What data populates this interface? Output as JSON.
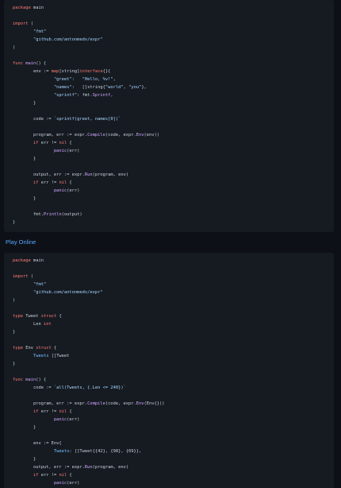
{
  "play_online": "Play Online",
  "colors": {
    "keyword": "#ff7b72",
    "string": "#a5d6ff",
    "function": "#d2a8ff",
    "type": "#79c0ff",
    "plain": "#c9d1d9",
    "link": "#58a6ff",
    "code_bg": "#161b22",
    "page_bg": "#0d1117"
  },
  "code_blocks": [
    {
      "lines": [
        {
          "row": 0,
          "tokens": [
            {
              "t": "package ",
              "c": "kw"
            },
            {
              "t": "main",
              "c": "pl"
            }
          ]
        },
        {
          "row": 2,
          "tokens": [
            {
              "t": "import ",
              "c": "kw"
            },
            {
              "t": "(",
              "c": "pl"
            }
          ]
        },
        {
          "row": 3,
          "tokens": [
            {
              "t": "        ",
              "c": "pl"
            },
            {
              "t": "\"fmt\"",
              "c": "str"
            }
          ]
        },
        {
          "row": 4,
          "tokens": [
            {
              "t": "        ",
              "c": "pl"
            },
            {
              "t": "\"github.com/antonmedv/expr\"",
              "c": "str"
            }
          ]
        },
        {
          "row": 5,
          "tokens": [
            {
              "t": ")",
              "c": "pl"
            }
          ]
        },
        {
          "row": 7,
          "tokens": [
            {
              "t": "func ",
              "c": "kw"
            },
            {
              "t": "main",
              "c": "fn"
            },
            {
              "t": "() {",
              "c": "pl"
            }
          ]
        },
        {
          "row": 8,
          "tokens": [
            {
              "t": "        env := ",
              "c": "pl"
            },
            {
              "t": "map",
              "c": "kw"
            },
            {
              "t": "[string]",
              "c": "pl"
            },
            {
              "t": "interface",
              "c": "kw"
            },
            {
              "t": "{}{",
              "c": "pl"
            }
          ]
        },
        {
          "row": 9,
          "tokens": [
            {
              "t": "                ",
              "c": "pl"
            },
            {
              "t": "\"greet\"",
              "c": "str"
            },
            {
              "t": ":   ",
              "c": "pl"
            },
            {
              "t": "\"Hello, %v!\"",
              "c": "str"
            },
            {
              "t": ",",
              "c": "pl"
            }
          ]
        },
        {
          "row": 10,
          "tokens": [
            {
              "t": "                ",
              "c": "pl"
            },
            {
              "t": "\"names\"",
              "c": "str"
            },
            {
              "t": ":   []string{",
              "c": "pl"
            },
            {
              "t": "\"world\"",
              "c": "str"
            },
            {
              "t": ", ",
              "c": "pl"
            },
            {
              "t": "\"you\"",
              "c": "str"
            },
            {
              "t": "},",
              "c": "pl"
            }
          ]
        },
        {
          "row": 11,
          "tokens": [
            {
              "t": "                ",
              "c": "pl"
            },
            {
              "t": "\"sprintf\"",
              "c": "str"
            },
            {
              "t": ": fmt.",
              "c": "pl"
            },
            {
              "t": "Sprintf",
              "c": "fn"
            },
            {
              "t": ",",
              "c": "pl"
            }
          ]
        },
        {
          "row": 12,
          "tokens": [
            {
              "t": "        }",
              "c": "pl"
            }
          ]
        },
        {
          "row": 14,
          "tokens": [
            {
              "t": "        code := ",
              "c": "pl"
            },
            {
              "t": "`sprintf(greet, names[0])`",
              "c": "str"
            }
          ]
        },
        {
          "row": 16,
          "tokens": [
            {
              "t": "        program, err := expr.",
              "c": "pl"
            },
            {
              "t": "Compile",
              "c": "fn"
            },
            {
              "t": "(code, expr.",
              "c": "pl"
            },
            {
              "t": "Env",
              "c": "fn"
            },
            {
              "t": "(env))",
              "c": "pl"
            }
          ]
        },
        {
          "row": 17,
          "tokens": [
            {
              "t": "        ",
              "c": "pl"
            },
            {
              "t": "if ",
              "c": "kw"
            },
            {
              "t": "err != ",
              "c": "pl"
            },
            {
              "t": "nil",
              "c": "kw"
            },
            {
              "t": " {",
              "c": "pl"
            }
          ]
        },
        {
          "row": 18,
          "tokens": [
            {
              "t": "                ",
              "c": "pl"
            },
            {
              "t": "panic",
              "c": "fn"
            },
            {
              "t": "(err)",
              "c": "pl"
            }
          ]
        },
        {
          "row": 19,
          "tokens": [
            {
              "t": "        }",
              "c": "pl"
            }
          ]
        },
        {
          "row": 21,
          "tokens": [
            {
              "t": "        output, err := expr.",
              "c": "pl"
            },
            {
              "t": "Run",
              "c": "fn"
            },
            {
              "t": "(program, env)",
              "c": "pl"
            }
          ]
        },
        {
          "row": 22,
          "tokens": [
            {
              "t": "        ",
              "c": "pl"
            },
            {
              "t": "if ",
              "c": "kw"
            },
            {
              "t": "err != ",
              "c": "pl"
            },
            {
              "t": "nil",
              "c": "kw"
            },
            {
              "t": " {",
              "c": "pl"
            }
          ]
        },
        {
          "row": 23,
          "tokens": [
            {
              "t": "                ",
              "c": "pl"
            },
            {
              "t": "panic",
              "c": "fn"
            },
            {
              "t": "(err)",
              "c": "pl"
            }
          ]
        },
        {
          "row": 24,
          "tokens": [
            {
              "t": "        }",
              "c": "pl"
            }
          ]
        },
        {
          "row": 26,
          "tokens": [
            {
              "t": "        fmt.",
              "c": "pl"
            },
            {
              "t": "Println",
              "c": "fn"
            },
            {
              "t": "(output)",
              "c": "pl"
            }
          ]
        },
        {
          "row": 27,
          "tokens": [
            {
              "t": "}",
              "c": "pl"
            }
          ]
        }
      ]
    },
    {
      "lines": [
        {
          "row": 0,
          "tokens": [
            {
              "t": "package ",
              "c": "kw"
            },
            {
              "t": "main",
              "c": "pl"
            }
          ]
        },
        {
          "row": 2,
          "tokens": [
            {
              "t": "import ",
              "c": "kw"
            },
            {
              "t": "(",
              "c": "pl"
            }
          ]
        },
        {
          "row": 3,
          "tokens": [
            {
              "t": "        ",
              "c": "pl"
            },
            {
              "t": "\"fmt\"",
              "c": "str"
            }
          ]
        },
        {
          "row": 4,
          "tokens": [
            {
              "t": "        ",
              "c": "pl"
            },
            {
              "t": "\"github.com/antonmedv/expr\"",
              "c": "str"
            }
          ]
        },
        {
          "row": 5,
          "tokens": [
            {
              "t": ")",
              "c": "pl"
            }
          ]
        },
        {
          "row": 7,
          "tokens": [
            {
              "t": "type ",
              "c": "kw"
            },
            {
              "t": "Tweet ",
              "c": "pl"
            },
            {
              "t": "struct",
              "c": "kw"
            },
            {
              "t": " {",
              "c": "pl"
            }
          ]
        },
        {
          "row": 8,
          "tokens": [
            {
              "t": "        Len ",
              "c": "pl"
            },
            {
              "t": "int",
              "c": "kw"
            }
          ]
        },
        {
          "row": 9,
          "tokens": [
            {
              "t": "}",
              "c": "pl"
            }
          ]
        },
        {
          "row": 11,
          "tokens": [
            {
              "t": "type ",
              "c": "kw"
            },
            {
              "t": "Env ",
              "c": "pl"
            },
            {
              "t": "struct",
              "c": "kw"
            },
            {
              "t": " {",
              "c": "pl"
            }
          ]
        },
        {
          "row": 12,
          "tokens": [
            {
              "t": "        ",
              "c": "pl"
            },
            {
              "t": "Tweets",
              "c": "ty"
            },
            {
              "t": " []Tweet",
              "c": "pl"
            }
          ]
        },
        {
          "row": 13,
          "tokens": [
            {
              "t": "}",
              "c": "pl"
            }
          ]
        },
        {
          "row": 15,
          "tokens": [
            {
              "t": "func ",
              "c": "kw"
            },
            {
              "t": "main",
              "c": "fn"
            },
            {
              "t": "() {",
              "c": "pl"
            }
          ]
        },
        {
          "row": 16,
          "tokens": [
            {
              "t": "        code := ",
              "c": "pl"
            },
            {
              "t": "`all(Tweets, {.Len <= 240})`",
              "c": "str"
            }
          ]
        },
        {
          "row": 18,
          "tokens": [
            {
              "t": "        program, err := expr.",
              "c": "pl"
            },
            {
              "t": "Compile",
              "c": "fn"
            },
            {
              "t": "(code, expr.",
              "c": "pl"
            },
            {
              "t": "Env",
              "c": "fn"
            },
            {
              "t": "(Env{}))",
              "c": "pl"
            }
          ]
        },
        {
          "row": 19,
          "tokens": [
            {
              "t": "        ",
              "c": "pl"
            },
            {
              "t": "if ",
              "c": "kw"
            },
            {
              "t": "err != ",
              "c": "pl"
            },
            {
              "t": "nil",
              "c": "kw"
            },
            {
              "t": " {",
              "c": "pl"
            }
          ]
        },
        {
          "row": 20,
          "tokens": [
            {
              "t": "                ",
              "c": "pl"
            },
            {
              "t": "panic",
              "c": "fn"
            },
            {
              "t": "(err)",
              "c": "pl"
            }
          ]
        },
        {
          "row": 21,
          "tokens": [
            {
              "t": "        }",
              "c": "pl"
            }
          ]
        },
        {
          "row": 23,
          "tokens": [
            {
              "t": "        env := Env{",
              "c": "pl"
            }
          ]
        },
        {
          "row": 24,
          "tokens": [
            {
              "t": "                ",
              "c": "pl"
            },
            {
              "t": "Tweets",
              "c": "ty"
            },
            {
              "t": ": []Tweet{{42}, {98}, {69}},",
              "c": "pl"
            }
          ]
        },
        {
          "row": 25,
          "tokens": [
            {
              "t": "        }",
              "c": "pl"
            }
          ]
        },
        {
          "row": 26,
          "tokens": [
            {
              "t": "        output, err := expr.",
              "c": "pl"
            },
            {
              "t": "Run",
              "c": "fn"
            },
            {
              "t": "(program, env)",
              "c": "pl"
            }
          ]
        },
        {
          "row": 27,
          "tokens": [
            {
              "t": "        ",
              "c": "pl"
            },
            {
              "t": "if ",
              "c": "kw"
            },
            {
              "t": "err != ",
              "c": "pl"
            },
            {
              "t": "nil",
              "c": "kw"
            },
            {
              "t": " {",
              "c": "pl"
            }
          ]
        },
        {
          "row": 28,
          "tokens": [
            {
              "t": "                ",
              "c": "pl"
            },
            {
              "t": "panic",
              "c": "fn"
            },
            {
              "t": "(err)",
              "c": "pl"
            }
          ]
        }
      ]
    }
  ]
}
